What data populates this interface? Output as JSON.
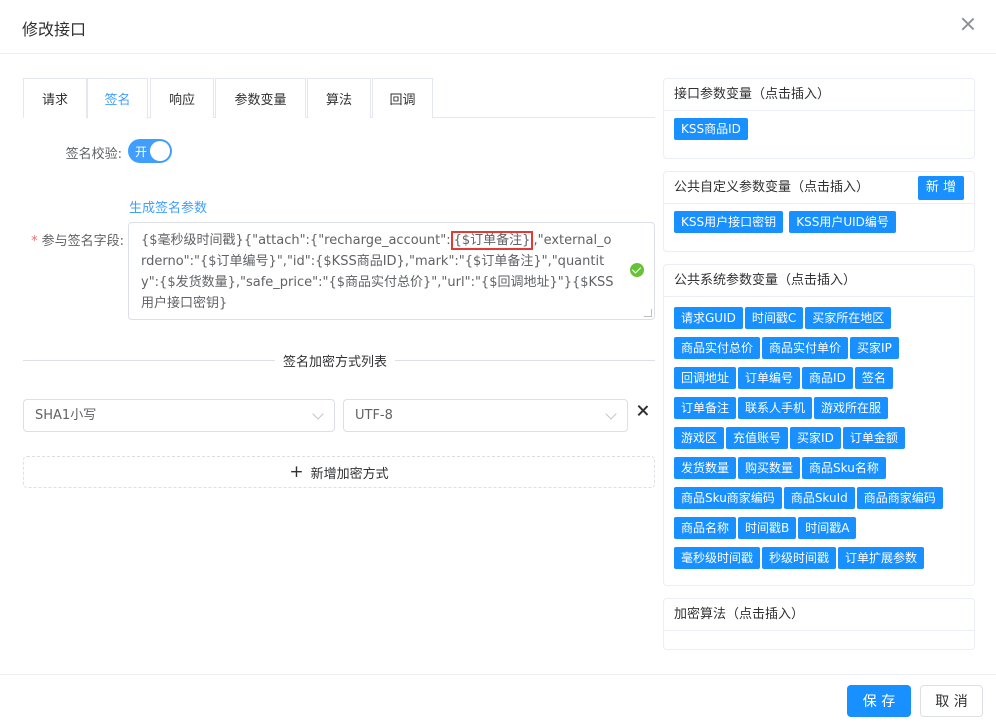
{
  "dialog": {
    "title": "修改接口"
  },
  "tabs": [
    {
      "label": "请求"
    },
    {
      "label": "签名"
    },
    {
      "label": "响应"
    },
    {
      "label": "参数变量"
    },
    {
      "label": "算法"
    },
    {
      "label": "回调"
    }
  ],
  "active_tab": "签名",
  "sign_check": {
    "label": "签名校验:",
    "switch_text": "开",
    "enabled": true
  },
  "generate_link": "生成签名参数",
  "sign_field": {
    "required_mark": "*",
    "label": "参与签名字段:",
    "part1": "{$毫秒级时间戳}{\"attach\":{\"recharge_account\":",
    "highlight": "{$订单备注}",
    "part2": ",\"external_orderno\":\"{$订单编号}\",\"id\":{$KSS商品ID},\"mark\":\"{$订单备注}\",\"quantity\":{$发货数量},\"safe_price\":\"{$商品实付总价}\",\"url\":\"{$回调地址}\"}{$KSS用户接口密钥}"
  },
  "encrypt_section": {
    "title": "签名加密方式列表",
    "algorithm": "SHA1小写",
    "encoding": "UTF-8",
    "add_label": "新增加密方式"
  },
  "panels": {
    "interface_params": {
      "title": "接口参数变量（点击插入）",
      "tags": [
        "KSS商品ID"
      ]
    },
    "custom_params": {
      "title": "公共自定义参数变量（点击插入）",
      "new_label": "新 增",
      "tags": [
        "KSS用户接口密钥",
        "KSS用户UID编号"
      ]
    },
    "system_params": {
      "title": "公共系统参数变量（点击插入）",
      "tags": [
        "请求GUID",
        "时间戳C",
        "买家所在地区",
        "商品实付总价",
        "商品实付单价",
        "买家IP",
        "回调地址",
        "订单编号",
        "商品ID",
        "签名",
        "订单备注",
        "联系人手机",
        "游戏所在服",
        "游戏区",
        "充值账号",
        "买家ID",
        "订单金额",
        "发货数量",
        "购买数量",
        "商品Sku名称",
        "商品Sku商家编码",
        "商品SkuId",
        "商品商家编码",
        "商品名称",
        "时间戳B",
        "时间戳A",
        "毫秒级时间戳",
        "秒级时间戳",
        "订单扩展参数"
      ]
    },
    "encrypt_algos": {
      "title": "加密算法（点击插入）"
    }
  },
  "footer": {
    "save_label": "保 存",
    "cancel_label": "取 消"
  },
  "colors": {
    "primary": "#409eff",
    "tag_blue": "#1890ff",
    "highlight_border": "#e53935",
    "success": "#67c23a"
  }
}
